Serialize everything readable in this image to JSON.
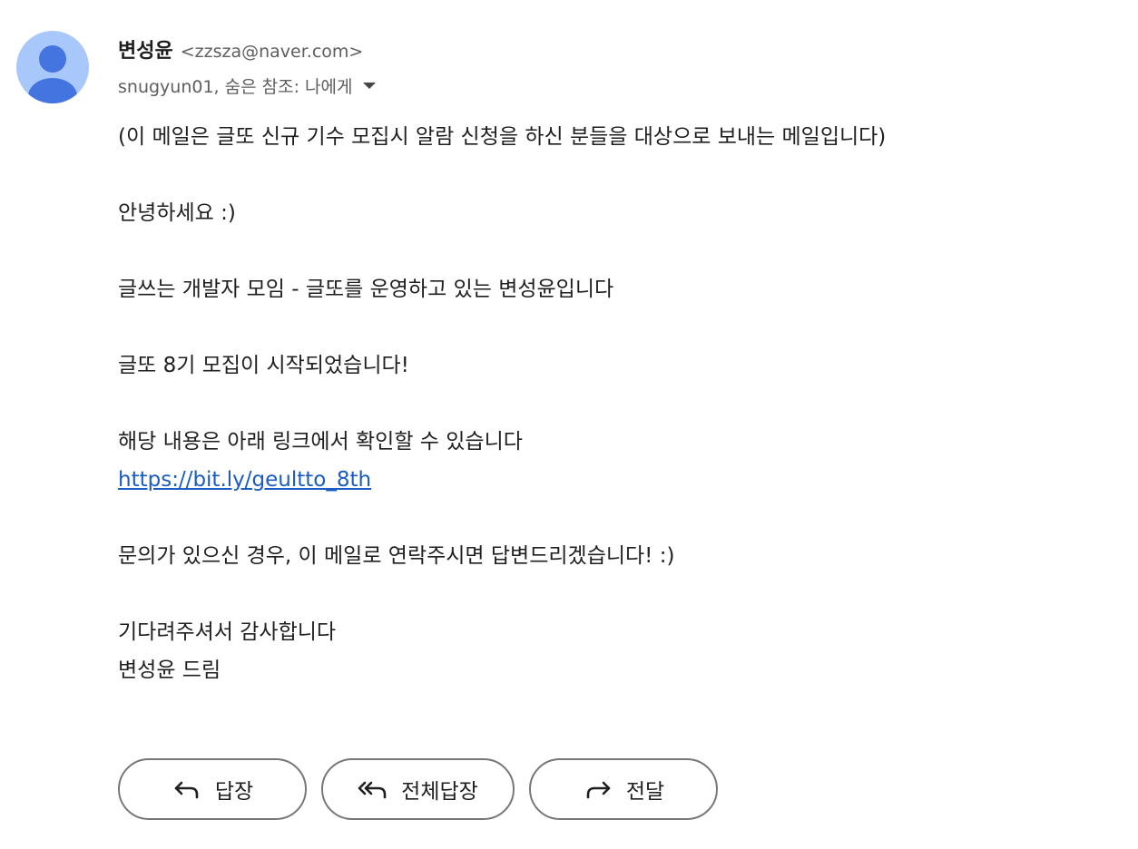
{
  "sender": {
    "name": "변성윤",
    "email": "<zzsza@naver.com>"
  },
  "recipients": {
    "text": "snugyun01, 숨은 참조: 나에게"
  },
  "body": {
    "intro": "(이 메일은 글또 신규 기수 모집시 알람 신청을 하신 분들을 대상으로 보내는 메일입니다)",
    "greeting": "안녕하세요 :)",
    "introduction": "글쓰는 개발자 모임 - 글또를 운영하고 있는 변성윤입니다",
    "announcement": "글또 8기 모집이 시작되었습니다!",
    "details": "해당 내용은 아래 링크에서 확인할 수 있습니다",
    "link": "https://bit.ly/geultto_8th",
    "contact": "문의가 있으신 경우, 이 메일로 연락주시면 답변드리겠습니다! :)",
    "thanks": "기다려주셔서 감사합니다",
    "signature": "변성윤 드림"
  },
  "actions": {
    "reply": "답장",
    "reply_all": "전체답장",
    "forward": "전달"
  },
  "colors": {
    "avatar_bg": "#a8c7fa",
    "avatar_fg": "#4374e0",
    "link": "#1a5bc4",
    "button_border": "#747775"
  },
  "icons": {
    "avatar": "person-icon",
    "recipients_toggle": "caret-down-icon",
    "reply": "reply-icon",
    "reply_all": "reply-all-icon",
    "forward": "forward-icon"
  }
}
